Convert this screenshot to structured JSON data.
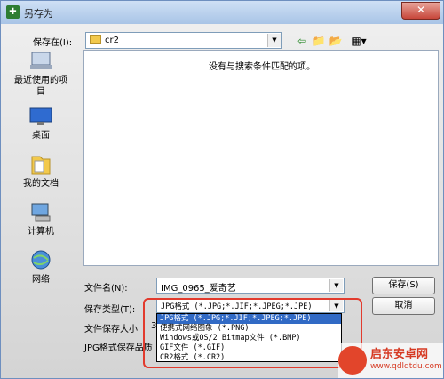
{
  "window": {
    "title": "另存为",
    "close": "✕"
  },
  "top": {
    "save_in_label": "保存在(I):",
    "location": "cr2",
    "empty_message": "没有与搜索条件匹配的项。"
  },
  "places": [
    {
      "label": "最近使用的项目"
    },
    {
      "label": "桌面"
    },
    {
      "label": "我的文档"
    },
    {
      "label": "计算机"
    },
    {
      "label": "网络"
    }
  ],
  "form": {
    "filename_label": "文件名(N):",
    "filename_value": "IMG_0965_爱奇艺",
    "filetype_label": "保存类型(T):",
    "filetype_value": "JPG格式 (*.JPG;*.JIF;*.JPEG;*.JPE)",
    "filesize_label": "文件保存大小",
    "filesize_partial": "3",
    "quality_label": "JPG格式保存品质",
    "save_button": "保存(S)",
    "cancel_button": "取消"
  },
  "filetype_options": [
    "JPG格式 (*.JPG;*.JIF;*.JPEG;*.JPE)",
    "便携式网络图象 (*.PNG)",
    "Windows或OS/2 Bitmap文件 (*.BMP)",
    "GIF文件 (*.GIF)",
    "CR2格式 (*.CR2)"
  ],
  "watermark": {
    "name": "启东安卓网",
    "url": "www.qdldtdu.com"
  },
  "colors": {
    "selection": "#316ac5",
    "highlight": "#e23b2e"
  }
}
